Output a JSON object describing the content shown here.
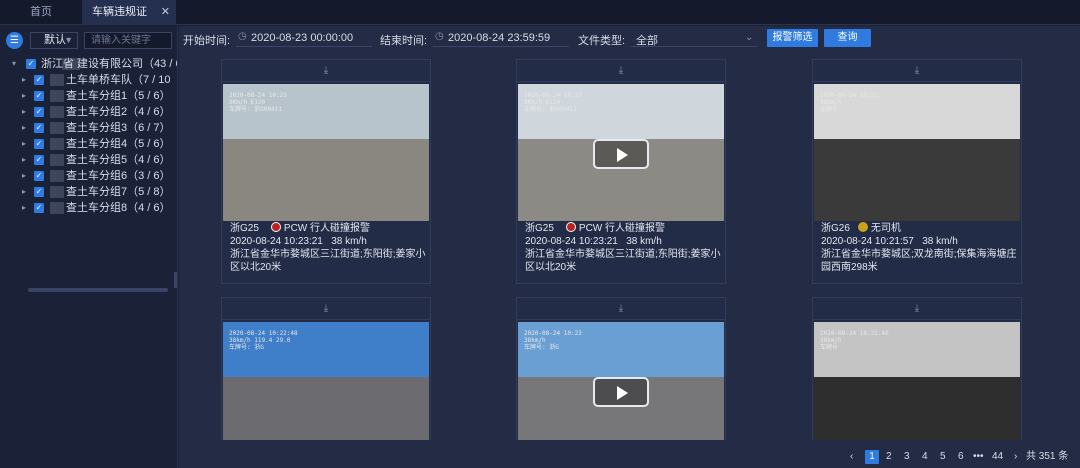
{
  "tabs": [
    {
      "label": "首页"
    },
    {
      "label": "车辆违规证"
    }
  ],
  "sidebar": {
    "selector": "默认",
    "search_placeholder": "请输入关键字",
    "tree": [
      {
        "label": "浙江省   建设有限公司（43 / 6",
        "level": 0
      },
      {
        "label": "土车单桥车队（7 / 10",
        "level": 1
      },
      {
        "label": "查土车分组1（5 / 6）",
        "level": 1
      },
      {
        "label": "查土车分组2（4 / 6）",
        "level": 1
      },
      {
        "label": "查土车分组3（6 / 7）",
        "level": 1
      },
      {
        "label": "查土车分组4（5 / 6）",
        "level": 1
      },
      {
        "label": "查土车分组5（4 / 6）",
        "level": 1
      },
      {
        "label": "查土车分组6（3 / 6）",
        "level": 1
      },
      {
        "label": "查土车分组7（5 / 8）",
        "level": 1
      },
      {
        "label": "查土车分组8（4 / 6）",
        "level": 1
      }
    ]
  },
  "filter": {
    "start_label": "开始时间:",
    "start_value": "2020-08-23 00:00:00",
    "end_label": "结束时间:",
    "end_value": "2020-08-24 23:59:59",
    "type_label": "文件类型:",
    "type_value": "全部",
    "alarm_button": "报警筛选",
    "query_button": "查询"
  },
  "cards": [
    {
      "plate": "浙G25",
      "alarm": "PCW 行人碰撞报警",
      "time": "2020-08-24 10:23:21",
      "speed": "38 km/h",
      "address": "浙江省金华市婺城区三江街道;东阳街;姜家小区以北20米",
      "video": false,
      "overlay": "2020-08-24 10:23\n9Km/h E120\n车牌号: 浙G00411",
      "sky": "#b8c4cc",
      "road": "#8a8780"
    },
    {
      "plate": "浙G25",
      "alarm": "PCW 行人碰撞报警",
      "time": "2020-08-24 10:23:21",
      "speed": "38 km/h",
      "address": "浙江省金华市婺城区三江街道;东阳街;姜家小区以北20米",
      "video": true,
      "overlay": "2020-08-24 10:23\n9Km/h E120\n车牌号: 浙G00411",
      "sky": "#cfd6dc",
      "road": "#8c8a84"
    },
    {
      "plate": "浙G26",
      "alarm": "无司机",
      "time": "2020-08-24 10:21:57",
      "speed": "38 km/h",
      "address": "浙江省金华市婺城区;双龙南街;保集海海塘庄园西南298米",
      "video": false,
      "overlay": "2020-08-24 10:21\n38km/h\n车牌号",
      "sky": "#d8d8d8",
      "road": "#3a3a3a"
    },
    {
      "plate": "",
      "alarm": "",
      "time": "",
      "speed": "",
      "address": "",
      "video": false,
      "overlay": "2020-08-24 10:22:48\n38km/h 119.4 29.0\n车牌号: 浙G",
      "sky": "#3f7ec8",
      "road": "#6c6c70"
    },
    {
      "plate": "",
      "alarm": "",
      "time": "",
      "speed": "",
      "address": "",
      "video": true,
      "overlay": "2020-08-24 10:23\n38km/h\n车牌号: 浙G",
      "sky": "#6a9fd4",
      "road": "#77777a"
    },
    {
      "plate": "",
      "alarm": "",
      "time": "",
      "speed": "",
      "address": "",
      "video": false,
      "overlay": "2020-08-24 10:23:40\n38km/h\n车牌号",
      "sky": "#c4c4c4",
      "road": "#2e2e2e"
    }
  ],
  "pager": {
    "prev": "‹",
    "pages": [
      "1",
      "2",
      "3",
      "4",
      "5",
      "6"
    ],
    "ellipsis": "•••",
    "last": "44",
    "next": "›",
    "total": "共 351 条"
  }
}
